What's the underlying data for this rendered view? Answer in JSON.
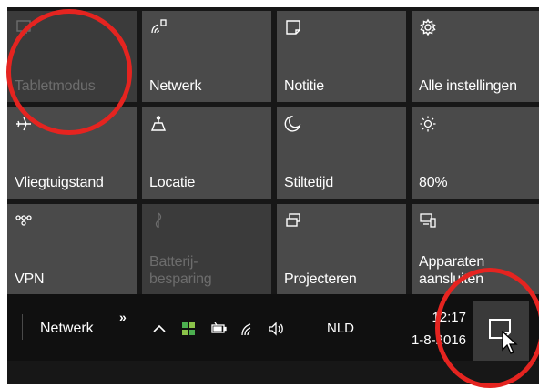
{
  "tiles": [
    {
      "label": "Tabletmodus",
      "icon": "tablet-mode-icon",
      "disabled": true
    },
    {
      "label": "Netwerk",
      "icon": "network-wifi-icon",
      "disabled": false
    },
    {
      "label": "Notitie",
      "icon": "note-icon",
      "disabled": false
    },
    {
      "label": "Alle instellingen",
      "icon": "gear-icon",
      "disabled": false
    },
    {
      "label": "Vliegtuigstand",
      "icon": "airplane-icon",
      "disabled": false
    },
    {
      "label": "Locatie",
      "icon": "location-icon",
      "disabled": false
    },
    {
      "label": "Stiltetijd",
      "icon": "moon-icon",
      "disabled": false
    },
    {
      "label": "80%",
      "icon": "brightness-icon",
      "disabled": false
    },
    {
      "label": "VPN",
      "icon": "vpn-icon",
      "disabled": false
    },
    {
      "label": "Batterij-besparing",
      "icon": "battery-saver-icon",
      "disabled": true
    },
    {
      "label": "Projecteren",
      "icon": "project-icon",
      "disabled": false
    },
    {
      "label": "Apparaten aansluiten",
      "icon": "connect-devices-icon",
      "disabled": false
    }
  ],
  "taskbar": {
    "toolbar_label": "Netwerk",
    "chevrons": "»",
    "language": "NLD",
    "time": "12:17",
    "date": "1-8-2016"
  },
  "colors": {
    "tile": "#4a4a4a",
    "tile_disabled": "#3b3b3b",
    "panel": "#171717",
    "annotation": "#e52420"
  }
}
